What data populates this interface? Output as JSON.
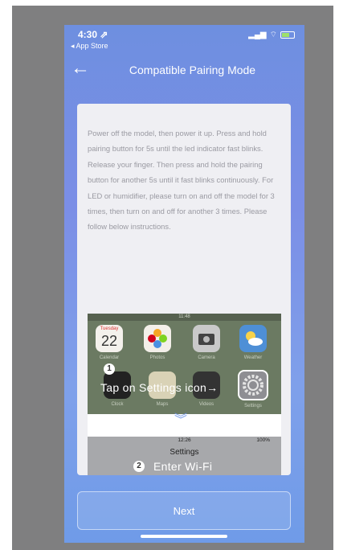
{
  "status_bar": {
    "time": "4:30 ⇗",
    "back_app": "◂ App Store",
    "signal": "▂▄▆",
    "wifi": "⌔"
  },
  "header": {
    "title": "Compatible Pairing Mode",
    "back_icon": "←"
  },
  "instructions": "Power off the model, then power it up. Press and hold pairing button for 5s until the led indicator fast blinks. Release your finger. Then press and hold the pairing button for another 5s until it fast blinks continuously. For LED or humidifier, please turn on and off the model for 3 times, then turn on and off for another 3 times. Please follow below instructions.",
  "guide": {
    "screen1_time": "11:48",
    "calendar_day": "Tuesday",
    "calendar_date": "22",
    "apps": [
      "Calendar",
      "Photos",
      "Camera",
      "Weather",
      "Clock",
      "Maps",
      "Videos",
      "Settings"
    ],
    "step1_number": "1",
    "step1_text": "Tap on Settings icon→",
    "chevron": "︾",
    "screen2_time": "12:26",
    "screen2_battery": "100%",
    "screen2_title": "Settings",
    "step2_number": "2",
    "step2_text": "Enter Wi-Fi"
  },
  "next_button": "Next",
  "colors": {
    "accent": "#6f96e8",
    "background_gradient_top": "#6e8fe0",
    "background_gradient_bottom": "#6f9be8"
  }
}
